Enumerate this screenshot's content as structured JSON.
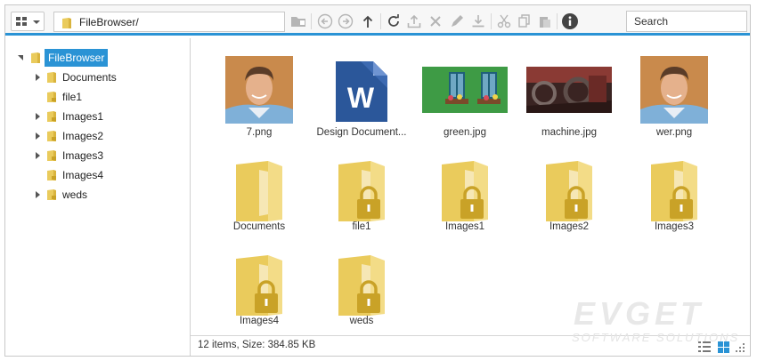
{
  "toolbar": {
    "path": "FileBrowser/",
    "search_placeholder": "Search",
    "icons": [
      "view-grid-icon",
      "new-folder-icon",
      "back-icon",
      "forward-icon",
      "up-icon",
      "refresh-icon",
      "upload-icon",
      "delete-icon",
      "rename-icon",
      "download-icon",
      "cut-icon",
      "copy-icon",
      "paste-icon",
      "info-icon"
    ]
  },
  "tree": {
    "root": "FileBrowser",
    "items": [
      {
        "label": "Documents",
        "expandable": true
      },
      {
        "label": "file1",
        "expandable": false
      },
      {
        "label": "Images1",
        "expandable": true
      },
      {
        "label": "Images2",
        "expandable": true
      },
      {
        "label": "Images3",
        "expandable": true
      },
      {
        "label": "Images4",
        "expandable": false
      },
      {
        "label": "weds",
        "expandable": true
      }
    ]
  },
  "files": [
    {
      "name": "7.png",
      "kind": "portrait"
    },
    {
      "name": "Design Document...",
      "kind": "word"
    },
    {
      "name": "green.jpg",
      "kind": "green"
    },
    {
      "name": "machine.jpg",
      "kind": "machine"
    },
    {
      "name": "wer.png",
      "kind": "portrait"
    },
    {
      "name": "Documents",
      "kind": "folder"
    },
    {
      "name": "file1",
      "kind": "locked"
    },
    {
      "name": "Images1",
      "kind": "locked"
    },
    {
      "name": "Images2",
      "kind": "locked"
    },
    {
      "name": "Images3",
      "kind": "locked"
    },
    {
      "name": "Images4",
      "kind": "locked"
    },
    {
      "name": "weds",
      "kind": "locked"
    }
  ],
  "status": {
    "info": "12 items, Size: 384.85 KB"
  },
  "watermark": {
    "line1": "EVGET",
    "line2": "SOFTWARE SOLUTIONS"
  },
  "colors": {
    "accent": "#2a93d5",
    "folder": "#eacb5c",
    "lock": "#c9a227",
    "word": "#2b579a"
  }
}
